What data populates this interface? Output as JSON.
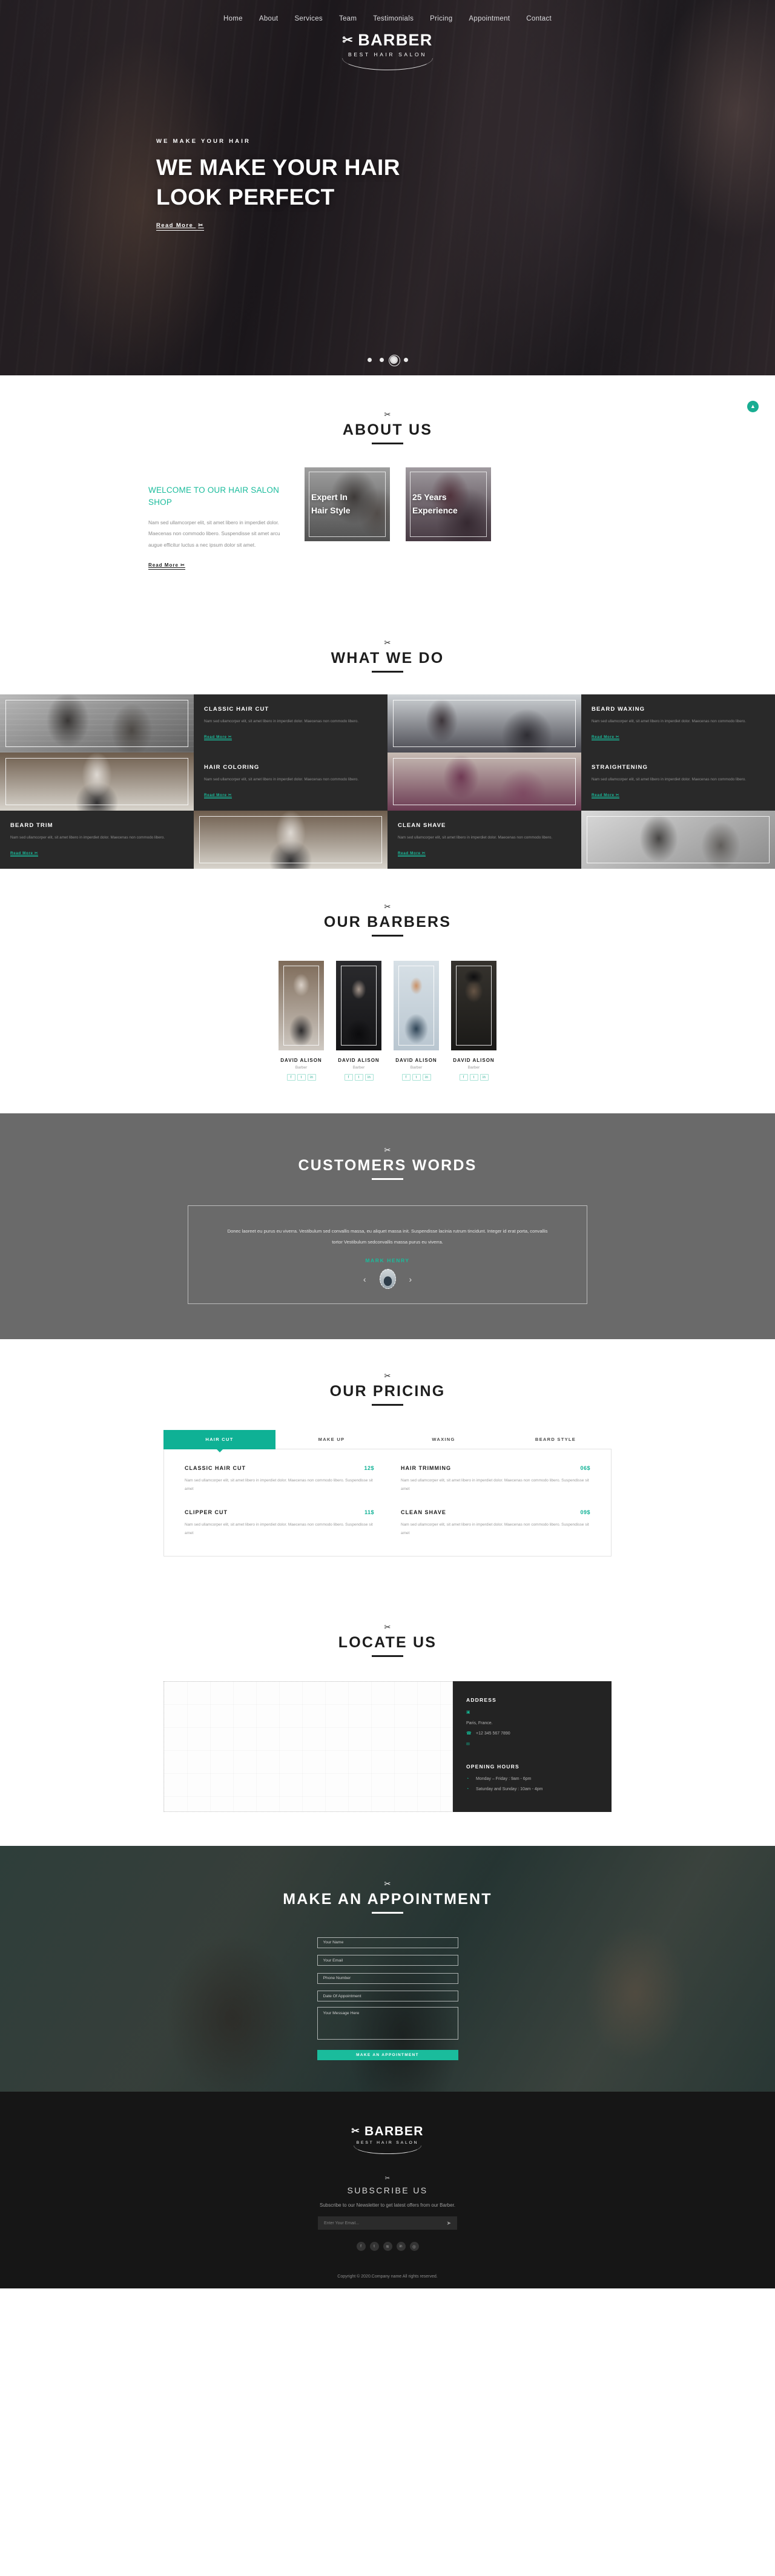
{
  "brand": {
    "name": "BARBER",
    "tagline": "BEST HAIR SALON",
    "scissors": "✂",
    "accent": "#1abc9c",
    "dark": "#232323"
  },
  "nav": {
    "items": [
      "Home",
      "About",
      "Services",
      "Team",
      "Testimonials",
      "Pricing",
      "Appointment",
      "Contact"
    ]
  },
  "hero": {
    "kicker": "WE MAKE YOUR HAIR",
    "title_line1": "WE MAKE YOUR HAIR",
    "title_line2": "LOOK PERFECT",
    "cta": "Read More",
    "dots": 4,
    "active_dot": 3
  },
  "about": {
    "heading": "ABOUT US",
    "subheading": "WELCOME TO OUR HAIR SALON SHOP",
    "body": "Nam sed ullamcorper elit, sit amet libero in imperdiet dolor. Maecenas non commodo libero. Suspendisse sit amet arcu augue efficitur luctus a nec ipsum dolor sit amet.",
    "cta": "Read More",
    "cards": [
      {
        "line1": "Expert In",
        "line2": "Hair Style"
      },
      {
        "line1": "25 Years",
        "line2": "Experience"
      }
    ],
    "scroll_top_label": "▲"
  },
  "services": {
    "heading": "WHAT WE DO",
    "body": "Nam sed ullamcorper elit, sit amet libero in imperdiet dolor. Maecenas non commodo libero.",
    "cta": "Read More",
    "items": [
      {
        "title": "CLASSIC HAIR CUT"
      },
      {
        "title": "BEARD WAXING"
      },
      {
        "title": "HAIR COLORING"
      },
      {
        "title": "STRAIGHTENING"
      },
      {
        "title": "BEARD TRIM"
      },
      {
        "title": "CLEAN SHAVE"
      }
    ]
  },
  "barbers": {
    "heading": "OUR BARBERS",
    "members": [
      {
        "name": "DAVID ALISON",
        "role": "Barber"
      },
      {
        "name": "DAVID ALISON",
        "role": "Barber"
      },
      {
        "name": "DAVID ALISON",
        "role": "Barber"
      },
      {
        "name": "DAVID ALISON",
        "role": "Barber"
      }
    ],
    "socials": [
      "f",
      "t",
      "in"
    ]
  },
  "testimonials": {
    "heading": "CUSTOMERS WORDS",
    "quote": "Donec laoreet eu purus eu viverra. Vestibulum sed convallis massa, eu aliquet massa init. Suspendisse lacinia rutrum tincidunt. Integer id erat porta, convallis tortor Vestibulum sedconvallis massa purus eu viverra.",
    "author": "MARK HENRY",
    "prev": "‹",
    "next": "›"
  },
  "pricing": {
    "heading": "OUR PRICING",
    "tabs": [
      "HAIR CUT",
      "MAKE UP",
      "WAXING",
      "BEARD STYLE"
    ],
    "active_tab": "HAIR CUT",
    "items": [
      {
        "name": "CLASSIC HAIR CUT",
        "price": "12$",
        "desc": "Nam sed ullamcorper elit, sit amet libero in imperdiet dolor. Maecenas non commodo libero. Suspendisse sit amet"
      },
      {
        "name": "HAIR TRIMMING",
        "price": "06$",
        "desc": "Nam sed ullamcorper elit, sit amet libero in imperdiet dolor. Maecenas non commodo libero. Suspendisse sit amet"
      },
      {
        "name": "CLIPPER CUT",
        "price": "11$",
        "desc": "Nam sed ullamcorper elit, sit amet libero in imperdiet dolor. Maecenas non commodo libero. Suspendisse sit amet"
      },
      {
        "name": "CLEAN SHAVE",
        "price": "09$",
        "desc": "Nam sed ullamcorper elit, sit amet libero in imperdiet dolor. Maecenas non commodo libero. Suspendisse sit amet"
      }
    ]
  },
  "locate": {
    "heading": "LOCATE US",
    "address_title": "ADDRESS",
    "address_line": "Paris, France.",
    "phone": "+12 345 567 7890",
    "hours_title": "OPENING HOURS",
    "hours": [
      "Monday – Friday : 9am - 6pm",
      "Saturday and Sunday : 10am - 4pm"
    ],
    "icons": {
      "map": "▣",
      "phone": "☎",
      "mail": "✉",
      "clock": "◔"
    }
  },
  "appointment": {
    "heading": "MAKE AN APPOINTMENT",
    "fields": [
      {
        "placeholder": "Your Name",
        "value": ""
      },
      {
        "placeholder": "Your Email",
        "value": ""
      },
      {
        "placeholder": "Phone Number",
        "value": ""
      },
      {
        "placeholder": "Date Of Appointment",
        "value": ""
      }
    ],
    "message_placeholder": "Your Message Here",
    "message_value": "",
    "submit": "MAKE AN APPOINTMENT"
  },
  "footer": {
    "subscribe_heading": "SUBSCRIBE US",
    "subscribe_desc": "Subscribe to our Newsletter to get latest offers from our Barber.",
    "email_placeholder": "Enter Your Email...",
    "email_value": "",
    "send_icon": "➤",
    "socials": [
      "f",
      "t",
      "≋",
      "in",
      "◎"
    ],
    "copyright": "Copyright © 2020.Company name All rights reserved."
  }
}
